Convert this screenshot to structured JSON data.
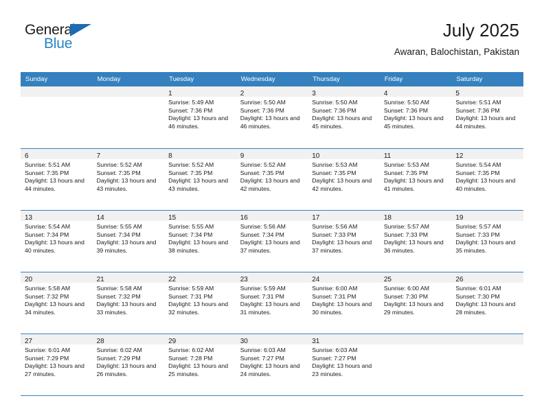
{
  "brand": {
    "name_dark": "General",
    "name_blue": "Blue",
    "accent_color": "#2683c6",
    "triangle_color": "#1b6cb0"
  },
  "header": {
    "title": "July 2025",
    "subtitle": "Awaran, Balochistan, Pakistan"
  },
  "calendar": {
    "header_bg": "#3580bf",
    "day_band_bg": "#f1f1f1",
    "weekday_names": [
      "Sunday",
      "Monday",
      "Tuesday",
      "Wednesday",
      "Thursday",
      "Friday",
      "Saturday"
    ],
    "weeks": [
      [
        {
          "day": "",
          "lines": []
        },
        {
          "day": "",
          "lines": []
        },
        {
          "day": "1",
          "lines": [
            "Sunrise: 5:49 AM",
            "Sunset: 7:36 PM",
            "Daylight: 13 hours and 46 minutes."
          ]
        },
        {
          "day": "2",
          "lines": [
            "Sunrise: 5:50 AM",
            "Sunset: 7:36 PM",
            "Daylight: 13 hours and 46 minutes."
          ]
        },
        {
          "day": "3",
          "lines": [
            "Sunrise: 5:50 AM",
            "Sunset: 7:36 PM",
            "Daylight: 13 hours and 45 minutes."
          ]
        },
        {
          "day": "4",
          "lines": [
            "Sunrise: 5:50 AM",
            "Sunset: 7:36 PM",
            "Daylight: 13 hours and 45 minutes."
          ]
        },
        {
          "day": "5",
          "lines": [
            "Sunrise: 5:51 AM",
            "Sunset: 7:36 PM",
            "Daylight: 13 hours and 44 minutes."
          ]
        }
      ],
      [
        {
          "day": "6",
          "lines": [
            "Sunrise: 5:51 AM",
            "Sunset: 7:35 PM",
            "Daylight: 13 hours and 44 minutes."
          ]
        },
        {
          "day": "7",
          "lines": [
            "Sunrise: 5:52 AM",
            "Sunset: 7:35 PM",
            "Daylight: 13 hours and 43 minutes."
          ]
        },
        {
          "day": "8",
          "lines": [
            "Sunrise: 5:52 AM",
            "Sunset: 7:35 PM",
            "Daylight: 13 hours and 43 minutes."
          ]
        },
        {
          "day": "9",
          "lines": [
            "Sunrise: 5:52 AM",
            "Sunset: 7:35 PM",
            "Daylight: 13 hours and 42 minutes."
          ]
        },
        {
          "day": "10",
          "lines": [
            "Sunrise: 5:53 AM",
            "Sunset: 7:35 PM",
            "Daylight: 13 hours and 42 minutes."
          ]
        },
        {
          "day": "11",
          "lines": [
            "Sunrise: 5:53 AM",
            "Sunset: 7:35 PM",
            "Daylight: 13 hours and 41 minutes."
          ]
        },
        {
          "day": "12",
          "lines": [
            "Sunrise: 5:54 AM",
            "Sunset: 7:35 PM",
            "Daylight: 13 hours and 40 minutes."
          ]
        }
      ],
      [
        {
          "day": "13",
          "lines": [
            "Sunrise: 5:54 AM",
            "Sunset: 7:34 PM",
            "Daylight: 13 hours and 40 minutes."
          ]
        },
        {
          "day": "14",
          "lines": [
            "Sunrise: 5:55 AM",
            "Sunset: 7:34 PM",
            "Daylight: 13 hours and 39 minutes."
          ]
        },
        {
          "day": "15",
          "lines": [
            "Sunrise: 5:55 AM",
            "Sunset: 7:34 PM",
            "Daylight: 13 hours and 38 minutes."
          ]
        },
        {
          "day": "16",
          "lines": [
            "Sunrise: 5:56 AM",
            "Sunset: 7:34 PM",
            "Daylight: 13 hours and 37 minutes."
          ]
        },
        {
          "day": "17",
          "lines": [
            "Sunrise: 5:56 AM",
            "Sunset: 7:33 PM",
            "Daylight: 13 hours and 37 minutes."
          ]
        },
        {
          "day": "18",
          "lines": [
            "Sunrise: 5:57 AM",
            "Sunset: 7:33 PM",
            "Daylight: 13 hours and 36 minutes."
          ]
        },
        {
          "day": "19",
          "lines": [
            "Sunrise: 5:57 AM",
            "Sunset: 7:33 PM",
            "Daylight: 13 hours and 35 minutes."
          ]
        }
      ],
      [
        {
          "day": "20",
          "lines": [
            "Sunrise: 5:58 AM",
            "Sunset: 7:32 PM",
            "Daylight: 13 hours and 34 minutes."
          ]
        },
        {
          "day": "21",
          "lines": [
            "Sunrise: 5:58 AM",
            "Sunset: 7:32 PM",
            "Daylight: 13 hours and 33 minutes."
          ]
        },
        {
          "day": "22",
          "lines": [
            "Sunrise: 5:59 AM",
            "Sunset: 7:31 PM",
            "Daylight: 13 hours and 32 minutes."
          ]
        },
        {
          "day": "23",
          "lines": [
            "Sunrise: 5:59 AM",
            "Sunset: 7:31 PM",
            "Daylight: 13 hours and 31 minutes."
          ]
        },
        {
          "day": "24",
          "lines": [
            "Sunrise: 6:00 AM",
            "Sunset: 7:31 PM",
            "Daylight: 13 hours and 30 minutes."
          ]
        },
        {
          "day": "25",
          "lines": [
            "Sunrise: 6:00 AM",
            "Sunset: 7:30 PM",
            "Daylight: 13 hours and 29 minutes."
          ]
        },
        {
          "day": "26",
          "lines": [
            "Sunrise: 6:01 AM",
            "Sunset: 7:30 PM",
            "Daylight: 13 hours and 28 minutes."
          ]
        }
      ],
      [
        {
          "day": "27",
          "lines": [
            "Sunrise: 6:01 AM",
            "Sunset: 7:29 PM",
            "Daylight: 13 hours and 27 minutes."
          ]
        },
        {
          "day": "28",
          "lines": [
            "Sunrise: 6:02 AM",
            "Sunset: 7:29 PM",
            "Daylight: 13 hours and 26 minutes."
          ]
        },
        {
          "day": "29",
          "lines": [
            "Sunrise: 6:02 AM",
            "Sunset: 7:28 PM",
            "Daylight: 13 hours and 25 minutes."
          ]
        },
        {
          "day": "30",
          "lines": [
            "Sunrise: 6:03 AM",
            "Sunset: 7:27 PM",
            "Daylight: 13 hours and 24 minutes."
          ]
        },
        {
          "day": "31",
          "lines": [
            "Sunrise: 6:03 AM",
            "Sunset: 7:27 PM",
            "Daylight: 13 hours and 23 minutes."
          ]
        },
        {
          "day": "",
          "lines": []
        },
        {
          "day": "",
          "lines": []
        }
      ]
    ]
  }
}
